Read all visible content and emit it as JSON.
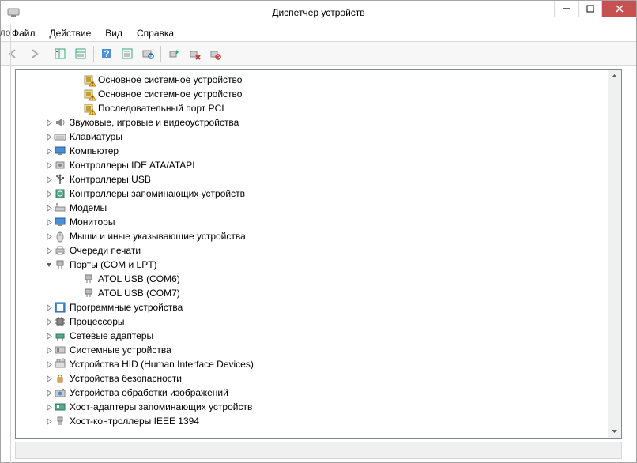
{
  "window": {
    "title": "Диспетчер устройств"
  },
  "menu": {
    "file": "Файл",
    "action": "Действие",
    "view": "Вид",
    "help": "Справка"
  },
  "left_sliver": "ло",
  "tree": [
    {
      "indent": 3,
      "expander": "none",
      "icon": "chip-warn",
      "label": "Основное системное устройство"
    },
    {
      "indent": 3,
      "expander": "none",
      "icon": "chip-warn",
      "label": "Основное системное устройство"
    },
    {
      "indent": 3,
      "expander": "none",
      "icon": "chip-warn",
      "label": "Последовательный порт PCI"
    },
    {
      "indent": 1,
      "expander": "closed",
      "icon": "audio",
      "label": "Звуковые, игровые и видеоустройства"
    },
    {
      "indent": 1,
      "expander": "closed",
      "icon": "keyboard",
      "label": "Клавиатуры"
    },
    {
      "indent": 1,
      "expander": "closed",
      "icon": "computer",
      "label": "Компьютер"
    },
    {
      "indent": 1,
      "expander": "closed",
      "icon": "ide",
      "label": "Контроллеры IDE ATA/ATAPI"
    },
    {
      "indent": 1,
      "expander": "closed",
      "icon": "usb",
      "label": "Контроллеры USB"
    },
    {
      "indent": 1,
      "expander": "closed",
      "icon": "storage",
      "label": "Контроллеры запоминающих устройств"
    },
    {
      "indent": 1,
      "expander": "closed",
      "icon": "modem",
      "label": "Модемы"
    },
    {
      "indent": 1,
      "expander": "closed",
      "icon": "monitor",
      "label": "Мониторы"
    },
    {
      "indent": 1,
      "expander": "closed",
      "icon": "mouse",
      "label": "Мыши и иные указывающие устройства"
    },
    {
      "indent": 1,
      "expander": "closed",
      "icon": "printer",
      "label": "Очереди печати"
    },
    {
      "indent": 1,
      "expander": "open",
      "icon": "port",
      "label": "Порты (COM и LPT)"
    },
    {
      "indent": 3,
      "expander": "none",
      "icon": "port",
      "label": "ATOL USB (COM6)"
    },
    {
      "indent": 3,
      "expander": "none",
      "icon": "port",
      "label": "ATOL USB (COM7)"
    },
    {
      "indent": 1,
      "expander": "closed",
      "icon": "software",
      "label": "Программные устройства"
    },
    {
      "indent": 1,
      "expander": "closed",
      "icon": "cpu",
      "label": "Процессоры"
    },
    {
      "indent": 1,
      "expander": "closed",
      "icon": "network",
      "label": "Сетевые адаптеры"
    },
    {
      "indent": 1,
      "expander": "closed",
      "icon": "system",
      "label": "Системные устройства"
    },
    {
      "indent": 1,
      "expander": "closed",
      "icon": "hid",
      "label": "Устройства HID (Human Interface Devices)"
    },
    {
      "indent": 1,
      "expander": "closed",
      "icon": "security",
      "label": "Устройства безопасности"
    },
    {
      "indent": 1,
      "expander": "closed",
      "icon": "imaging",
      "label": "Устройства обработки изображений"
    },
    {
      "indent": 1,
      "expander": "closed",
      "icon": "hostadapter",
      "label": "Хост-адаптеры запоминающих устройств"
    },
    {
      "indent": 1,
      "expander": "closed",
      "icon": "ieee1394",
      "label": "Хост-контроллеры IEEE 1394"
    }
  ]
}
